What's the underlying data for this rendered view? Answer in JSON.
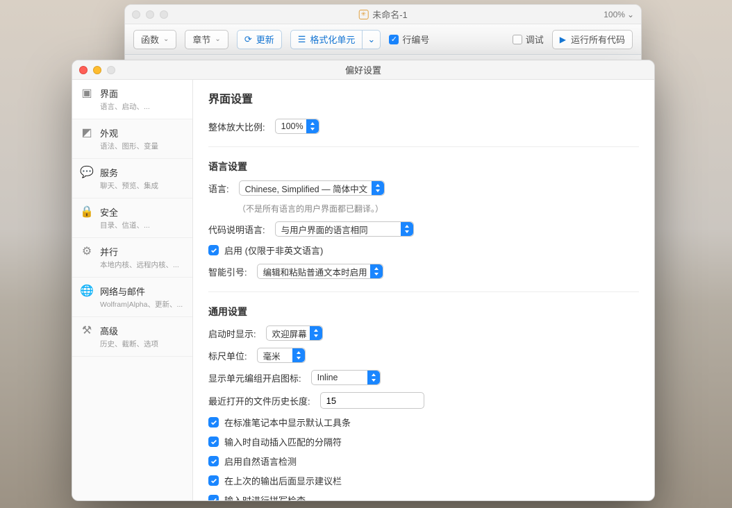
{
  "back": {
    "title": "未命名-1",
    "zoom": "100%",
    "toolbar": {
      "function": "函数",
      "chapter": "章节",
      "refresh": "更新",
      "format_cell": "格式化单元",
      "line_no": "行编号",
      "debug": "调试",
      "run_all": "运行所有代码"
    }
  },
  "prefs": {
    "title": "偏好设置",
    "sidebar": [
      {
        "label": "界面",
        "sub": "语言、启动、..."
      },
      {
        "label": "外观",
        "sub": "语法、图形、变量"
      },
      {
        "label": "服务",
        "sub": "聊天、预览、集成"
      },
      {
        "label": "安全",
        "sub": "目录、信道、..."
      },
      {
        "label": "并行",
        "sub": "本地内核、远程内核、..."
      },
      {
        "label": "网络与邮件",
        "sub": "Wolfram|Alpha、更新、..."
      },
      {
        "label": "高级",
        "sub": "历史、截断、选项"
      }
    ],
    "content": {
      "heading": "界面设置",
      "magnification_label": "整体放大比例:",
      "magnification_value": "100%",
      "lang_heading": "语言设置",
      "lang_label": "语言:",
      "lang_value": "Chinese, Simplified — 简体中文",
      "lang_hint": "（不是所有语言的用户界面都已翻译。）",
      "code_lang_label": "代码说明语言:",
      "code_lang_value": "与用户界面的语言相同",
      "enable_label": "启用 (仅限于非英文语言)",
      "smart_quotes_label": "智能引号:",
      "smart_quotes_value": "编辑和粘贴普通文本时启用",
      "general_heading": "通用设置",
      "startup_label": "启动时显示:",
      "startup_value": "欢迎屏幕",
      "ruler_label": "标尺单位:",
      "ruler_value": "毫米",
      "opener_label": "显示单元编组开启图标:",
      "opener_value": "Inline",
      "history_label": "最近打开的文件历史长度:",
      "history_value": "15",
      "chk1": "在标准笔记本中显示默认工具条",
      "chk2": "输入时自动插入匹配的分隔符",
      "chk3": "启用自然语言检测",
      "chk4": "在上次的输出后面显示建议栏",
      "chk5": "输入时进行拼写检查"
    }
  }
}
